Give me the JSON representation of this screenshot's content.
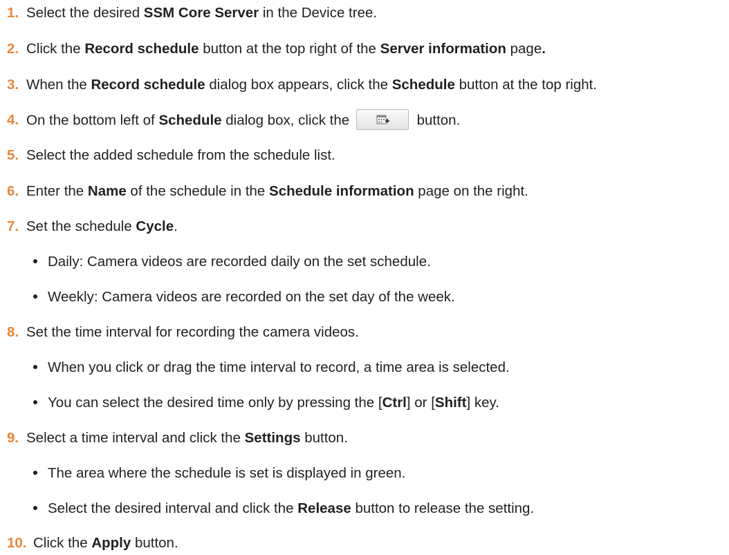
{
  "steps": [
    {
      "num": "1.",
      "parts": [
        {
          "t": "Select the desired "
        },
        {
          "t": "SSM Core Server",
          "b": true
        },
        {
          "t": " in the Device tree."
        }
      ]
    },
    {
      "num": "2.",
      "parts": [
        {
          "t": "Click the "
        },
        {
          "t": "Record schedule",
          "b": true
        },
        {
          "t": " button at the top right of the "
        },
        {
          "t": "Server information",
          "b": true
        },
        {
          "t": " page"
        },
        {
          "t": ".",
          "b": true
        }
      ]
    },
    {
      "num": "3.",
      "parts": [
        {
          "t": "When the "
        },
        {
          "t": "Record schedule",
          "b": true
        },
        {
          "t": " dialog box appears, click the "
        },
        {
          "t": "Schedule",
          "b": true
        },
        {
          "t": " button at the top right."
        }
      ]
    },
    {
      "num": "4.",
      "parts": [
        {
          "t": "On the bottom left of "
        },
        {
          "t": "Schedule",
          "b": true
        },
        {
          "t": " dialog box, click the "
        },
        {
          "btn": "add-schedule-icon"
        },
        {
          "t": " button."
        }
      ]
    },
    {
      "num": "5.",
      "parts": [
        {
          "t": "Select the added schedule from the schedule list."
        }
      ]
    },
    {
      "num": "6.",
      "parts": [
        {
          "t": "Enter the "
        },
        {
          "t": "Name",
          "b": true
        },
        {
          "t": " of the schedule in the "
        },
        {
          "t": "Schedule information",
          "b": true
        },
        {
          "t": " page on the right."
        }
      ]
    },
    {
      "num": "7.",
      "parts": [
        {
          "t": "Set the schedule "
        },
        {
          "t": "Cycle",
          "b": true
        },
        {
          "t": "."
        }
      ]
    },
    {
      "num": "8.",
      "parts": [
        {
          "t": "Set the time interval for recording the camera videos."
        }
      ]
    },
    {
      "num": "9.",
      "parts": [
        {
          "t": "Select a time interval and click the "
        },
        {
          "t": "Settings",
          "b": true
        },
        {
          "t": " button."
        }
      ]
    },
    {
      "num": "10.",
      "parts": [
        {
          "t": "Click the "
        },
        {
          "t": "Apply",
          "b": true
        },
        {
          "t": " button."
        }
      ]
    }
  ],
  "bullets": [
    {
      "parts": [
        {
          "t": "Daily: Camera videos are recorded daily on the set schedule."
        }
      ]
    },
    {
      "parts": [
        {
          "t": "Weekly: Camera videos are recorded on the set day of the week."
        }
      ]
    },
    {
      "parts": [
        {
          "t": "When you click or drag the time interval to record, a time area is selected."
        }
      ]
    },
    {
      "parts": [
        {
          "t": "You can select the desired time only by pressing the ["
        },
        {
          "t": "Ctrl",
          "b": true
        },
        {
          "t": "] or ["
        },
        {
          "t": "Shift",
          "b": true
        },
        {
          "t": "] key."
        }
      ]
    },
    {
      "parts": [
        {
          "t": "The area where the schedule is set is displayed in green."
        }
      ]
    },
    {
      "parts": [
        {
          "t": "Select the desired interval and click the "
        },
        {
          "t": "Release",
          "b": true
        },
        {
          "t": " button to release the setting."
        }
      ]
    }
  ],
  "colors": {
    "step_number": "#e8873a",
    "text": "#231f20"
  }
}
